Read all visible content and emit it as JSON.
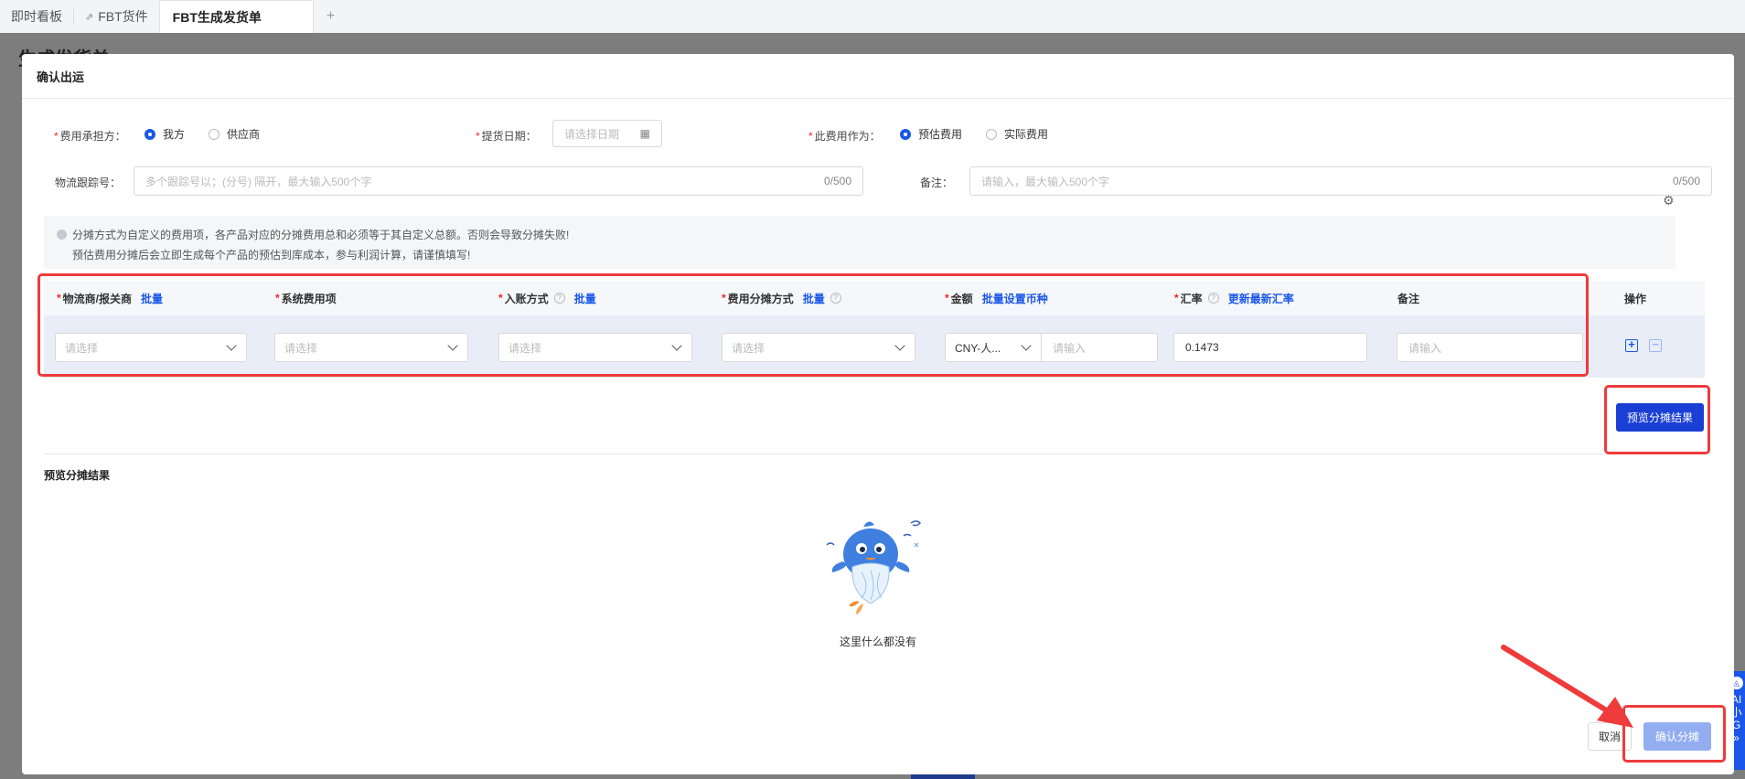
{
  "tabs": [
    {
      "label": "即时看板"
    },
    {
      "label": "FBT货件",
      "pin": "⇗"
    },
    {
      "label": "FBT生成发货单"
    }
  ],
  "tab_add": "+",
  "background": {
    "page_title": "生成发货单"
  },
  "side_widget": {
    "lines": [
      "AI",
      "小",
      "G",
      "»"
    ]
  },
  "modal": {
    "title": "确认出运",
    "form": {
      "bearer": {
        "label": "费用承担方：",
        "options": [
          "我方",
          "供应商"
        ],
        "selected": "我方"
      },
      "pickup_date": {
        "label": "提货日期：",
        "placeholder": "请选择日期"
      },
      "fee_as": {
        "label": "此费用作为：",
        "options": [
          "预估费用",
          "实际费用"
        ],
        "selected": "预估费用"
      },
      "tracking": {
        "label": "物流跟踪号：",
        "placeholder": "多个跟踪号以；(分号) 隔开，最大输入500个字",
        "count": "0/500"
      },
      "remark": {
        "label": "备注：",
        "placeholder": "请输入，最大输入500个字",
        "count": "0/500"
      }
    },
    "notice": {
      "line1": "分摊方式为自定义的费用项，各产品对应的分摊费用总和必须等于其自定义总额。否则会导致分摊失败!",
      "line2": "预估费用分摊后会立即生成每个产品的预估到库成本，参与利润计算，请谨慎填写!"
    },
    "table": {
      "columns": [
        {
          "label": "物流商/报关商",
          "required": "*",
          "link": "批量"
        },
        {
          "label": "系统费用项",
          "required": "*"
        },
        {
          "label": "入账方式",
          "required": "*",
          "help": "?",
          "link": "批量"
        },
        {
          "label": "费用分摊方式",
          "required": "*",
          "link": "批量",
          "help": "?"
        },
        {
          "label": "金额",
          "required": "*",
          "link": "批量设置币种"
        },
        {
          "label": "汇率",
          "required": "*",
          "help": "?",
          "link": "更新最新汇率"
        },
        {
          "label": "备注"
        }
      ],
      "op_header": "操作",
      "row": {
        "provider_placeholder": "请选择",
        "fee_item_placeholder": "请选择",
        "accounting_placeholder": "请选择",
        "allocation_placeholder": "请选择",
        "currency": "CNY-人...",
        "amount_placeholder": "请输入",
        "rate": "0.1473",
        "remark_placeholder": "请输入",
        "add": "+",
        "remove": "−"
      }
    },
    "preview_button": "预览分摊结果",
    "preview_title": "预览分摊结果",
    "empty_text": "这里什么都没有",
    "cancel": "取消",
    "confirm": "确认分摊"
  },
  "colors": {
    "accent": "#1a56e8",
    "primary_button": "#1a3fd4",
    "annotation": "#ef3b3b"
  }
}
